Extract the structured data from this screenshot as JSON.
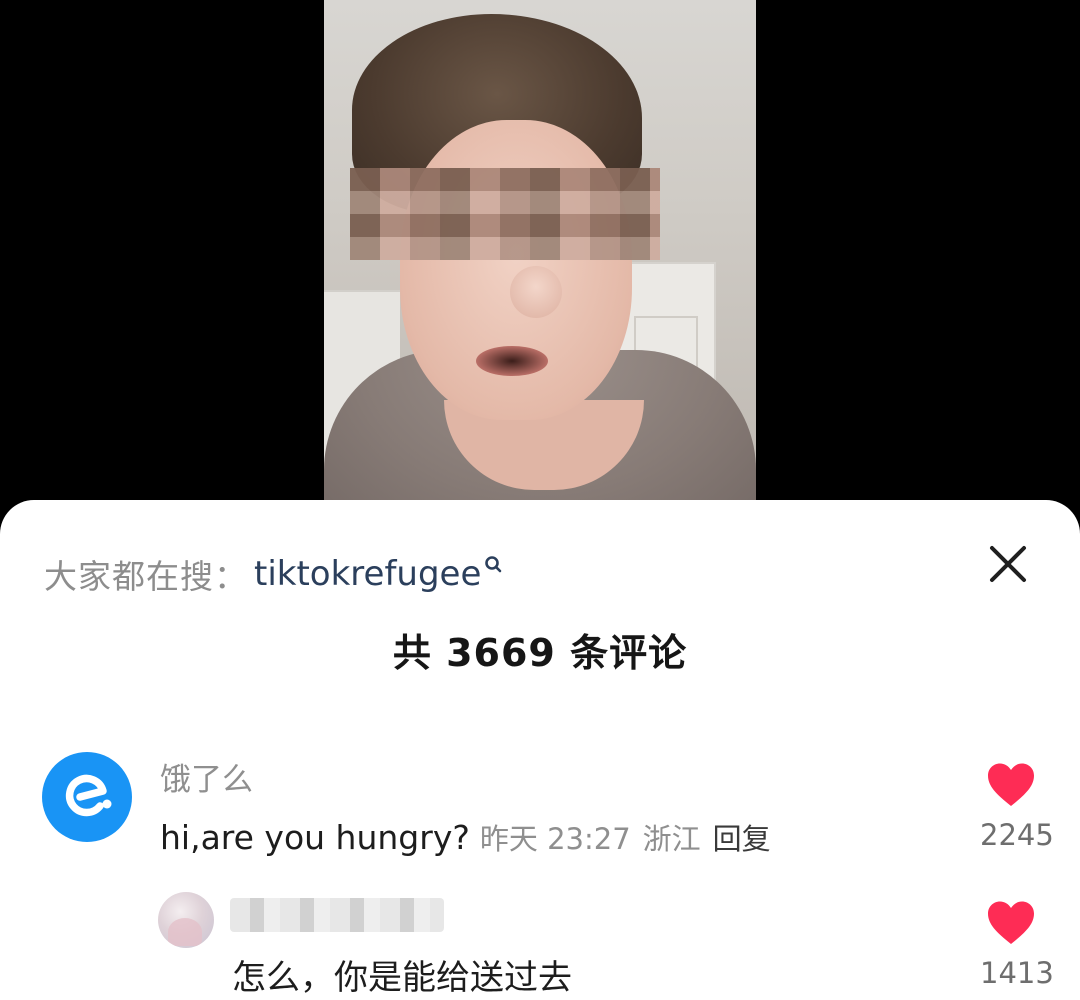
{
  "search": {
    "prefix": "大家都在搜：",
    "term": "tiktokrefugee"
  },
  "sheet": {
    "title": "共 3669 条评论"
  },
  "comments": [
    {
      "username": "饿了么",
      "text": "hi,are you hungry?",
      "time": "昨天 23:27",
      "location": "浙江",
      "reply_label": "回复",
      "likes": "2245"
    },
    {
      "username": "",
      "text": "怎么，你是能给送过去",
      "likes": "1413"
    }
  ],
  "colors": {
    "accent_blue": "#1994f5",
    "heart_red": "#fe2c55",
    "search_term": "#2b3f5c"
  },
  "icons": {
    "close": "close-icon",
    "search": "search-icon",
    "like": "heart-icon",
    "avatar": "eleme-logo-icon"
  }
}
